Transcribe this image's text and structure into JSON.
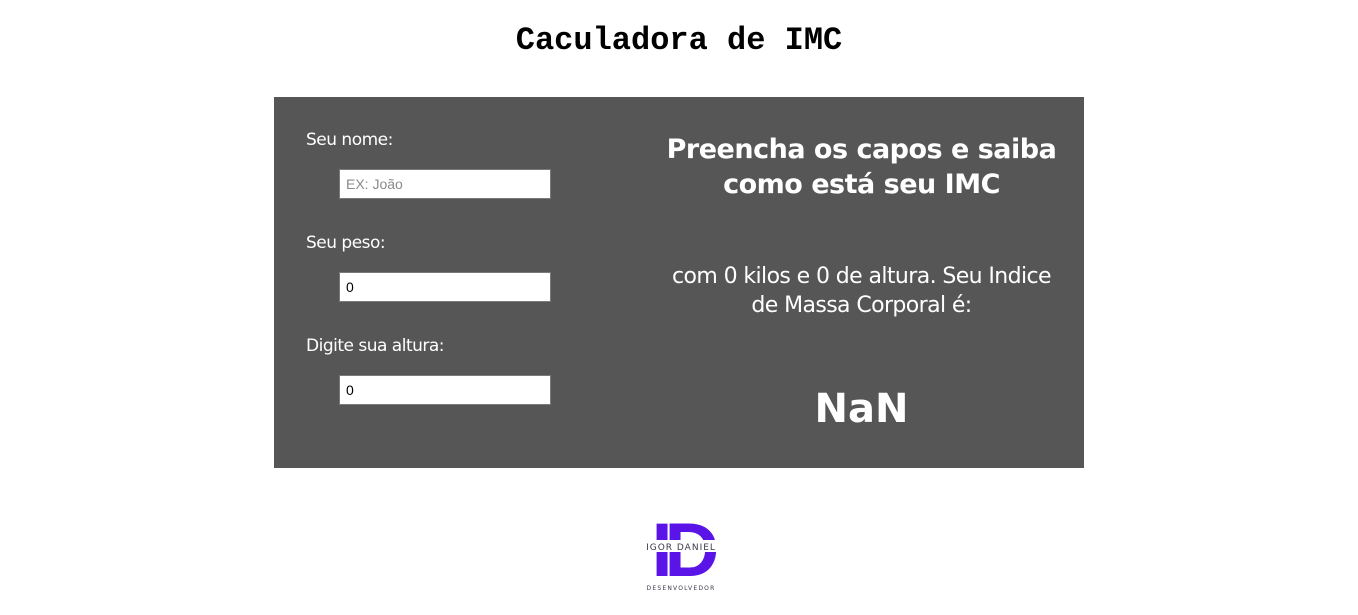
{
  "header": {
    "title": "Caculadora de IMC"
  },
  "form": {
    "name_label": "Seu nome:",
    "name_placeholder": "EX: João",
    "name_value": "",
    "weight_label": "Seu peso:",
    "weight_value": "0",
    "height_label": "Digite sua altura:",
    "height_value": "0"
  },
  "result": {
    "heading": "Preencha os capos e saiba como está seu IMC",
    "description": "com 0 kilos e 0 de altura. Seu Indice de Massa Corporal é:",
    "value": "NaN"
  },
  "logo": {
    "initials": "ID",
    "name": "IGOR DANIEL",
    "subtitle": "DESENVOLVEDOR",
    "color": "#5b14e8"
  },
  "colors": {
    "panel_background": "#565656",
    "panel_text": "#ffffff"
  }
}
